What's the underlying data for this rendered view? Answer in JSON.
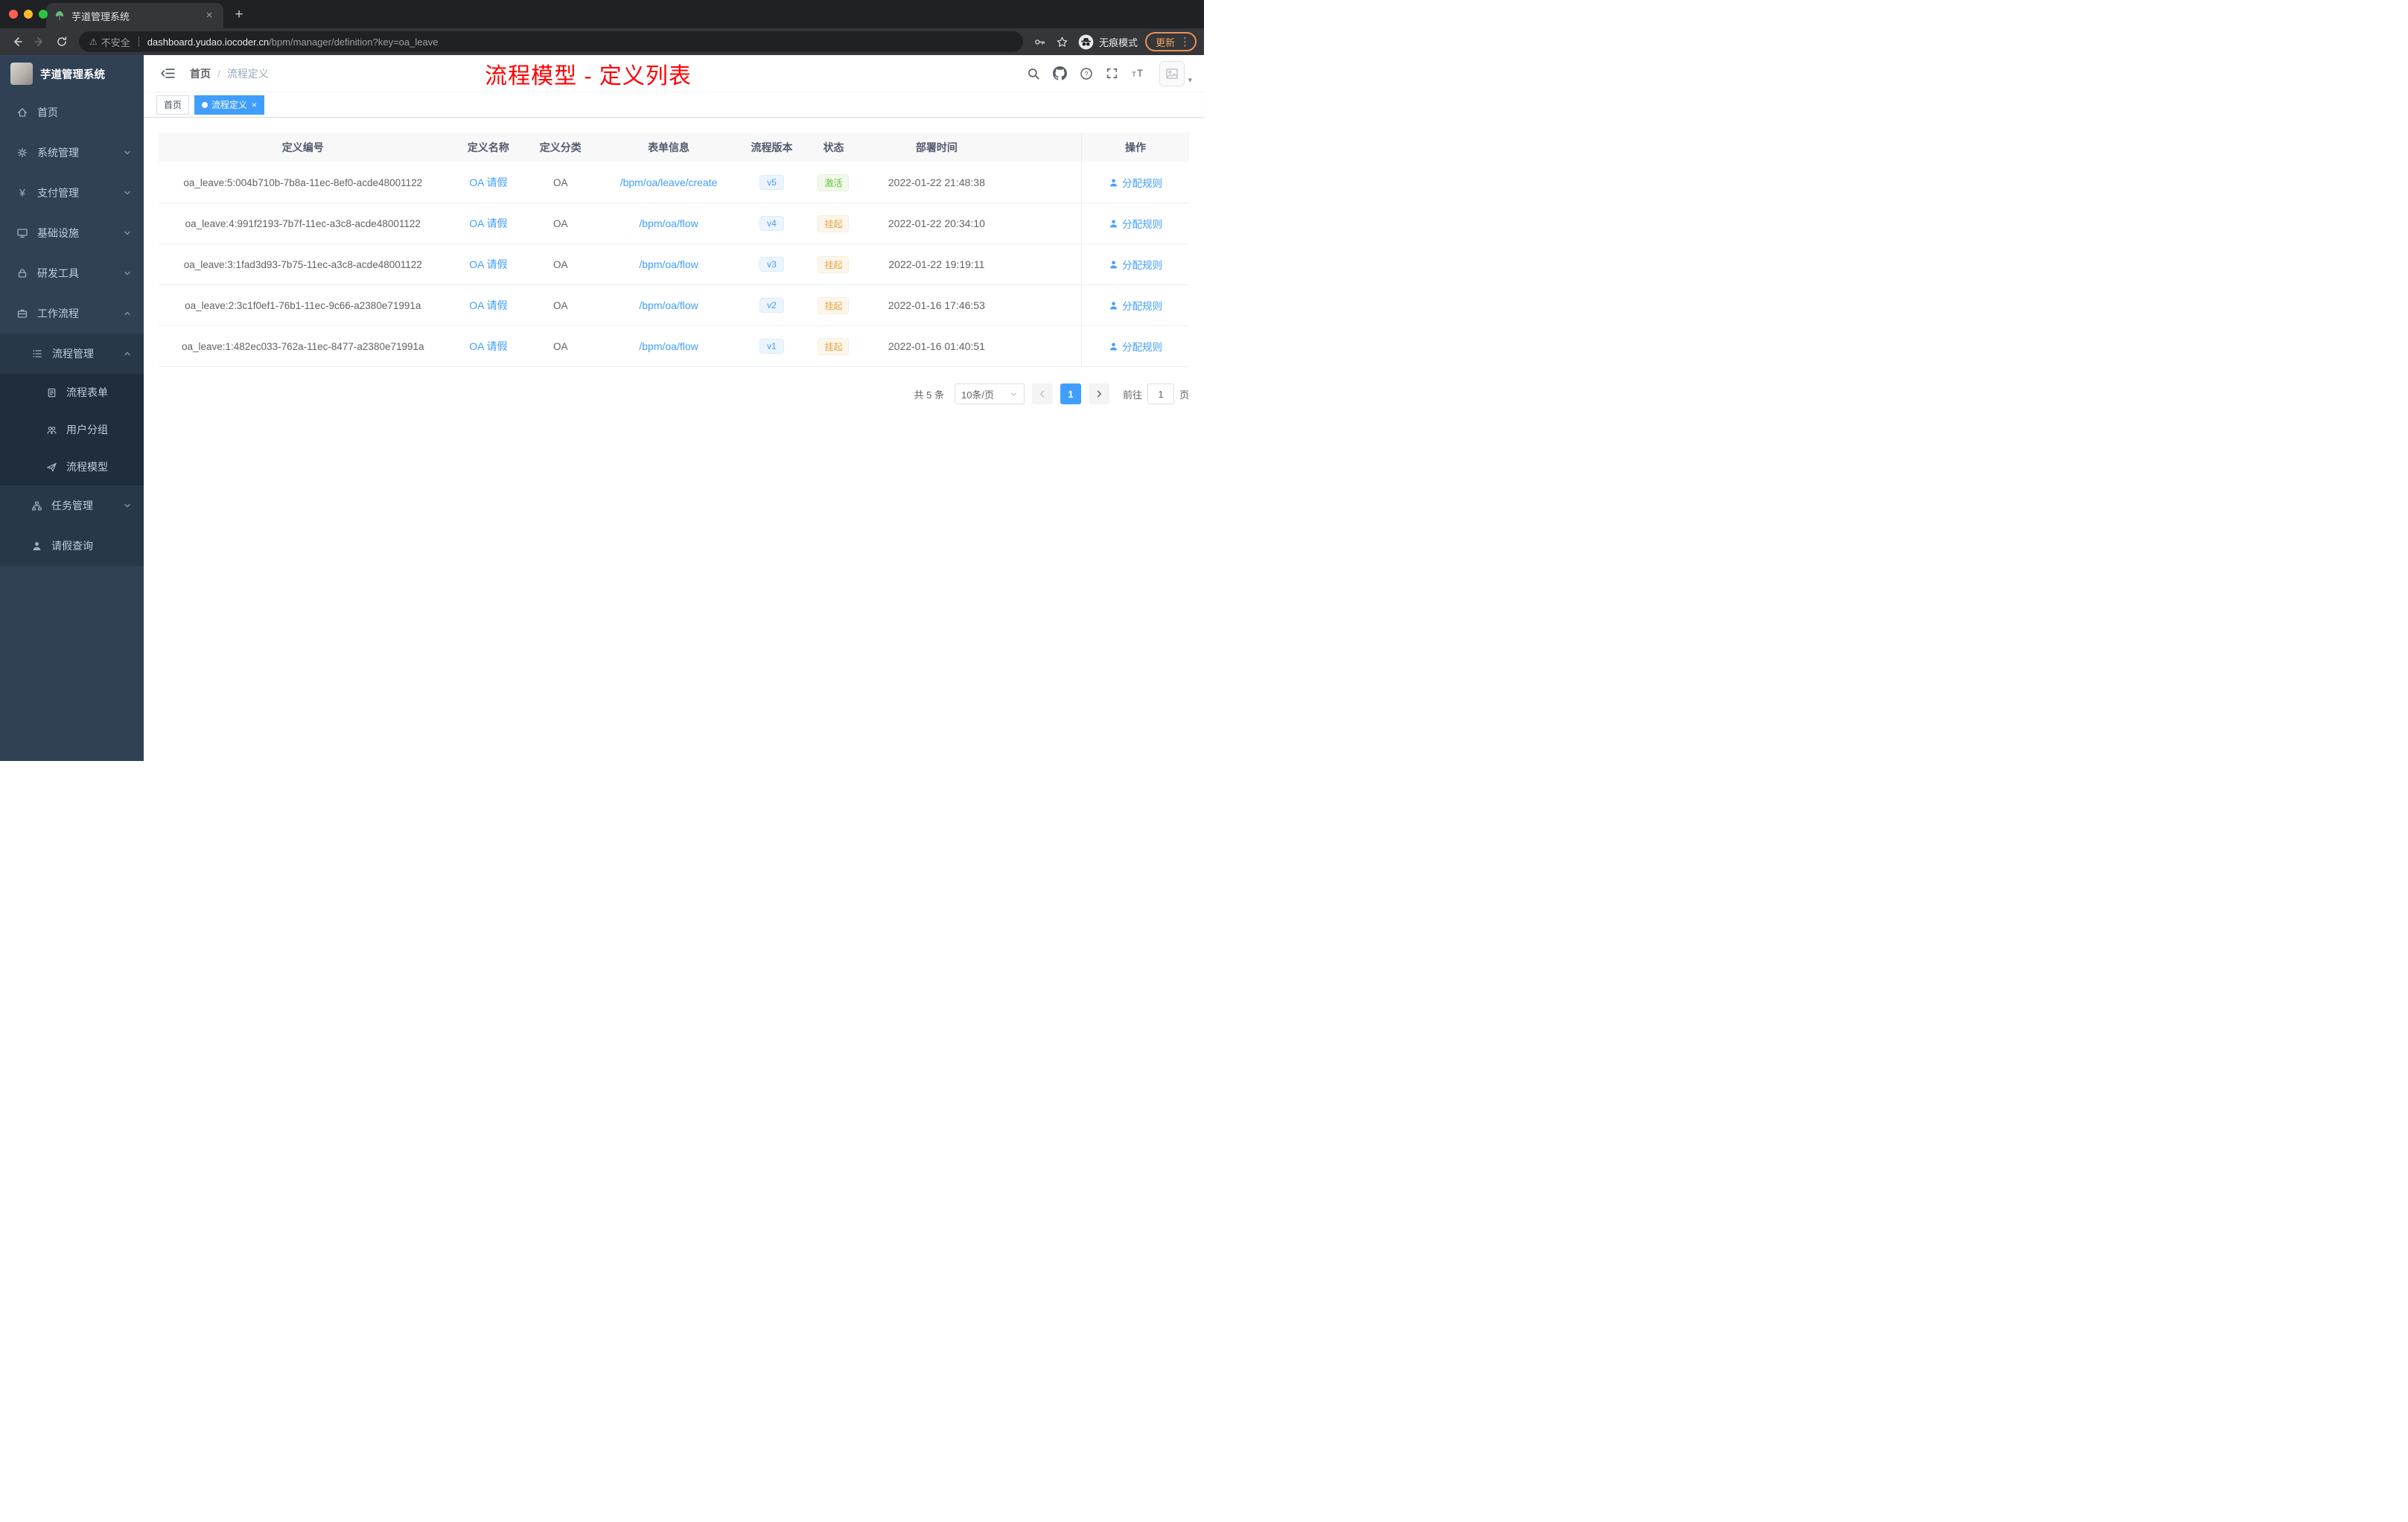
{
  "theme": {
    "accent": "#409eff",
    "success": "#67c23a",
    "warning": "#e6a23c",
    "annotation_red": "#ff0000",
    "sidebar_bg": "#304156",
    "chrome_bg": "#202124"
  },
  "glyphs": {
    "close": "×",
    "plus": "+",
    "warning": "⚠",
    "star": "☆",
    "dots": "⋮",
    "caret_down": "▾"
  },
  "browser": {
    "tab_title": "芋道管理系统",
    "security_label": "不安全",
    "url_host": "dashboard.yudao.iocoder.cn",
    "url_path": "/bpm/manager/definition?key=oa_leave",
    "incognito_label": "无痕模式",
    "update_label": "更新"
  },
  "sidebar": {
    "logo_title": "芋道管理系统",
    "items": [
      {
        "label": "首页"
      },
      {
        "label": "系统管理"
      },
      {
        "label": "支付管理"
      },
      {
        "label": "基础设施"
      },
      {
        "label": "研发工具"
      },
      {
        "label": "工作流程"
      },
      {
        "label": "流程管理"
      },
      {
        "label": "流程表单"
      },
      {
        "label": "用户分组"
      },
      {
        "label": "流程模型"
      },
      {
        "label": "任务管理"
      },
      {
        "label": "请假查询"
      }
    ]
  },
  "header": {
    "breadcrumb_home": "首页",
    "breadcrumb_current": "流程定义",
    "annotation": "流程模型 - 定义列表"
  },
  "tags": {
    "home": "首页",
    "active": "流程定义"
  },
  "table": {
    "columns": [
      "定义编号",
      "定义名称",
      "定义分类",
      "表单信息",
      "流程版本",
      "状态",
      "部署时间",
      "操作"
    ],
    "action_label": "分配规则",
    "rows": [
      {
        "id": "oa_leave:5:004b710b-7b8a-11ec-8ef0-acde48001122",
        "name": "OA 请假",
        "category": "OA",
        "form": "/bpm/oa/leave/create",
        "version": "v5",
        "status": "激活",
        "status_type": "success",
        "deployed": "2022-01-22 21:48:38"
      },
      {
        "id": "oa_leave:4:991f2193-7b7f-11ec-a3c8-acde48001122",
        "name": "OA 请假",
        "category": "OA",
        "form": "/bpm/oa/flow",
        "version": "v4",
        "status": "挂起",
        "status_type": "warning",
        "deployed": "2022-01-22 20:34:10"
      },
      {
        "id": "oa_leave:3:1fad3d93-7b75-11ec-a3c8-acde48001122",
        "name": "OA 请假",
        "category": "OA",
        "form": "/bpm/oa/flow",
        "version": "v3",
        "status": "挂起",
        "status_type": "warning",
        "deployed": "2022-01-22 19:19:11"
      },
      {
        "id": "oa_leave:2:3c1f0ef1-76b1-11ec-9c66-a2380e71991a",
        "name": "OA 请假",
        "category": "OA",
        "form": "/bpm/oa/flow",
        "version": "v2",
        "status": "挂起",
        "status_type": "warning",
        "deployed": "2022-01-16 17:46:53"
      },
      {
        "id": "oa_leave:1:482ec033-762a-11ec-8477-a2380e71991a",
        "name": "OA 请假",
        "category": "OA",
        "form": "/bpm/oa/flow",
        "version": "v1",
        "status": "挂起",
        "status_type": "warning",
        "deployed": "2022-01-16 01:40:51"
      }
    ]
  },
  "pagination": {
    "total_label": "共 5 条",
    "page_size_label": "10条/页",
    "current_page": "1",
    "goto_label": "前往",
    "goto_value": "1",
    "page_unit_label": "页"
  }
}
